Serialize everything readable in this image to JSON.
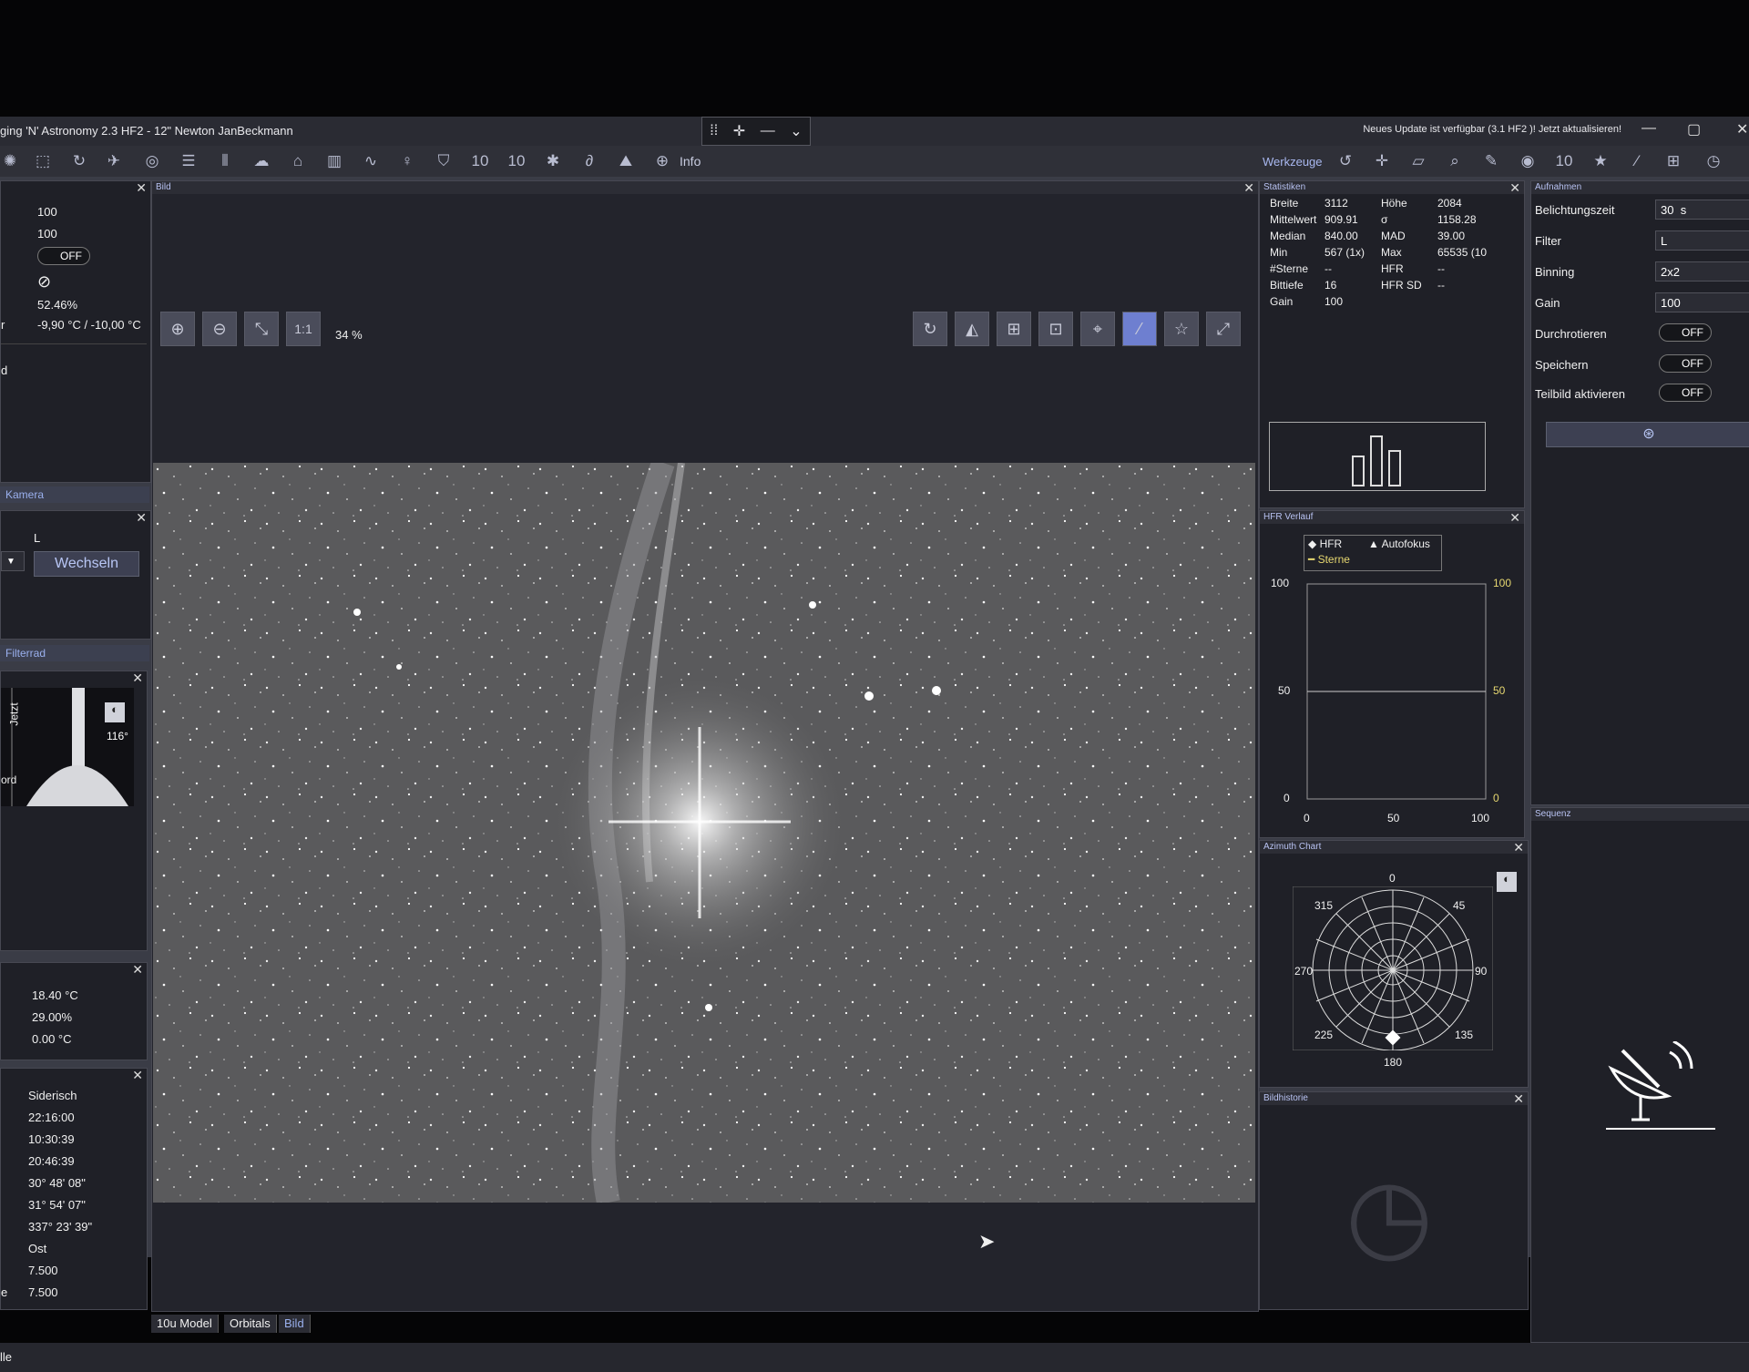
{
  "titlebar": {
    "title": "ging 'N' Astronomy 2.3 HF2  -  12\" Newton JanBeckmann",
    "update_notice": "Neues Update ist verfügbar (3.1 HF2 )! Jetzt aktualisieren!",
    "window_buttons": [
      "—",
      "▢",
      "✕"
    ]
  },
  "toolbar": {
    "info_label": "Info",
    "tools_label": "Werkzeuge"
  },
  "left": {
    "camera_values": [
      "100",
      "100"
    ],
    "camera_toggle": "OFF",
    "cooler_power": "52.46%",
    "temperature": "-9,90 °C / -10,00 °C",
    "temp_prefix": "r",
    "partial_label": "d",
    "camera_tab": "Kamera",
    "filter_current": "L",
    "switch_button": "Wechseln",
    "filterwheel_tab": "Filterrad",
    "altitude_now": "Jetzt",
    "altitude_deg": "116°",
    "altitude_dir": "ord",
    "weather": [
      "18.40 °C",
      "29.00%",
      "0.00 °C"
    ],
    "telescope": [
      "Siderisch",
      "22:16:00",
      "10:30:39",
      "20:46:39",
      "30° 48' 08\"",
      "31° 54' 07\"",
      "337° 23' 39\"",
      "Ost",
      "7.500",
      "7.500"
    ],
    "telescope_prefix": "e"
  },
  "image": {
    "panel_title": "Bild",
    "zoom_1to1": "1:1",
    "zoom_level": "34 %",
    "tabs": [
      "10u Model",
      "Orbitals",
      "Bild"
    ]
  },
  "stats": {
    "panel_title": "Statistiken",
    "rows": [
      [
        "Breite",
        "3112",
        "Höhe",
        "2084"
      ],
      [
        "Mittelwert",
        "909.91",
        "σ",
        "1158.28"
      ],
      [
        "Median",
        "840.00",
        "MAD",
        "39.00"
      ],
      [
        "Min",
        "567 (1x)",
        "Max",
        "65535 (10"
      ],
      [
        "#Sterne",
        "--",
        "HFR",
        "--"
      ],
      [
        "Bittiefe",
        "16",
        "HFR SD",
        "--"
      ],
      [
        "Gain",
        "100",
        "",
        ""
      ]
    ]
  },
  "hfr": {
    "panel_title": "HFR Verlauf",
    "legend": [
      "HFR",
      "Autofokus",
      "Sterne"
    ],
    "y_ticks": [
      "100",
      "50",
      "0"
    ],
    "x_ticks": [
      "0",
      "50",
      "100"
    ]
  },
  "azimuth": {
    "panel_title": "Azimuth Chart",
    "labels": [
      "0",
      "45",
      "90",
      "135",
      "180",
      "225",
      "270",
      "315"
    ]
  },
  "history": {
    "panel_title": "Bildhistorie"
  },
  "capture": {
    "panel_title": "Aufnahmen",
    "exposure_label": "Belichtungszeit",
    "exposure_value": "30",
    "exposure_unit": "s",
    "filter_label": "Filter",
    "filter_value": "L",
    "binning_label": "Binning",
    "binning_value": "2x2",
    "gain_label": "Gain",
    "gain_value": "100",
    "dither_label": "Durchrotieren",
    "dither_value": "OFF",
    "save_label": "Speichern",
    "save_value": "OFF",
    "subframe_label": "Teilbild aktivieren",
    "subframe_value": "OFF"
  },
  "sequence": {
    "panel_title": "Sequenz"
  },
  "status": {
    "left_text": "lle"
  },
  "colors": {
    "accent": "#a9b8f0",
    "panel": "#1f2027",
    "background": "#3a3c46"
  }
}
